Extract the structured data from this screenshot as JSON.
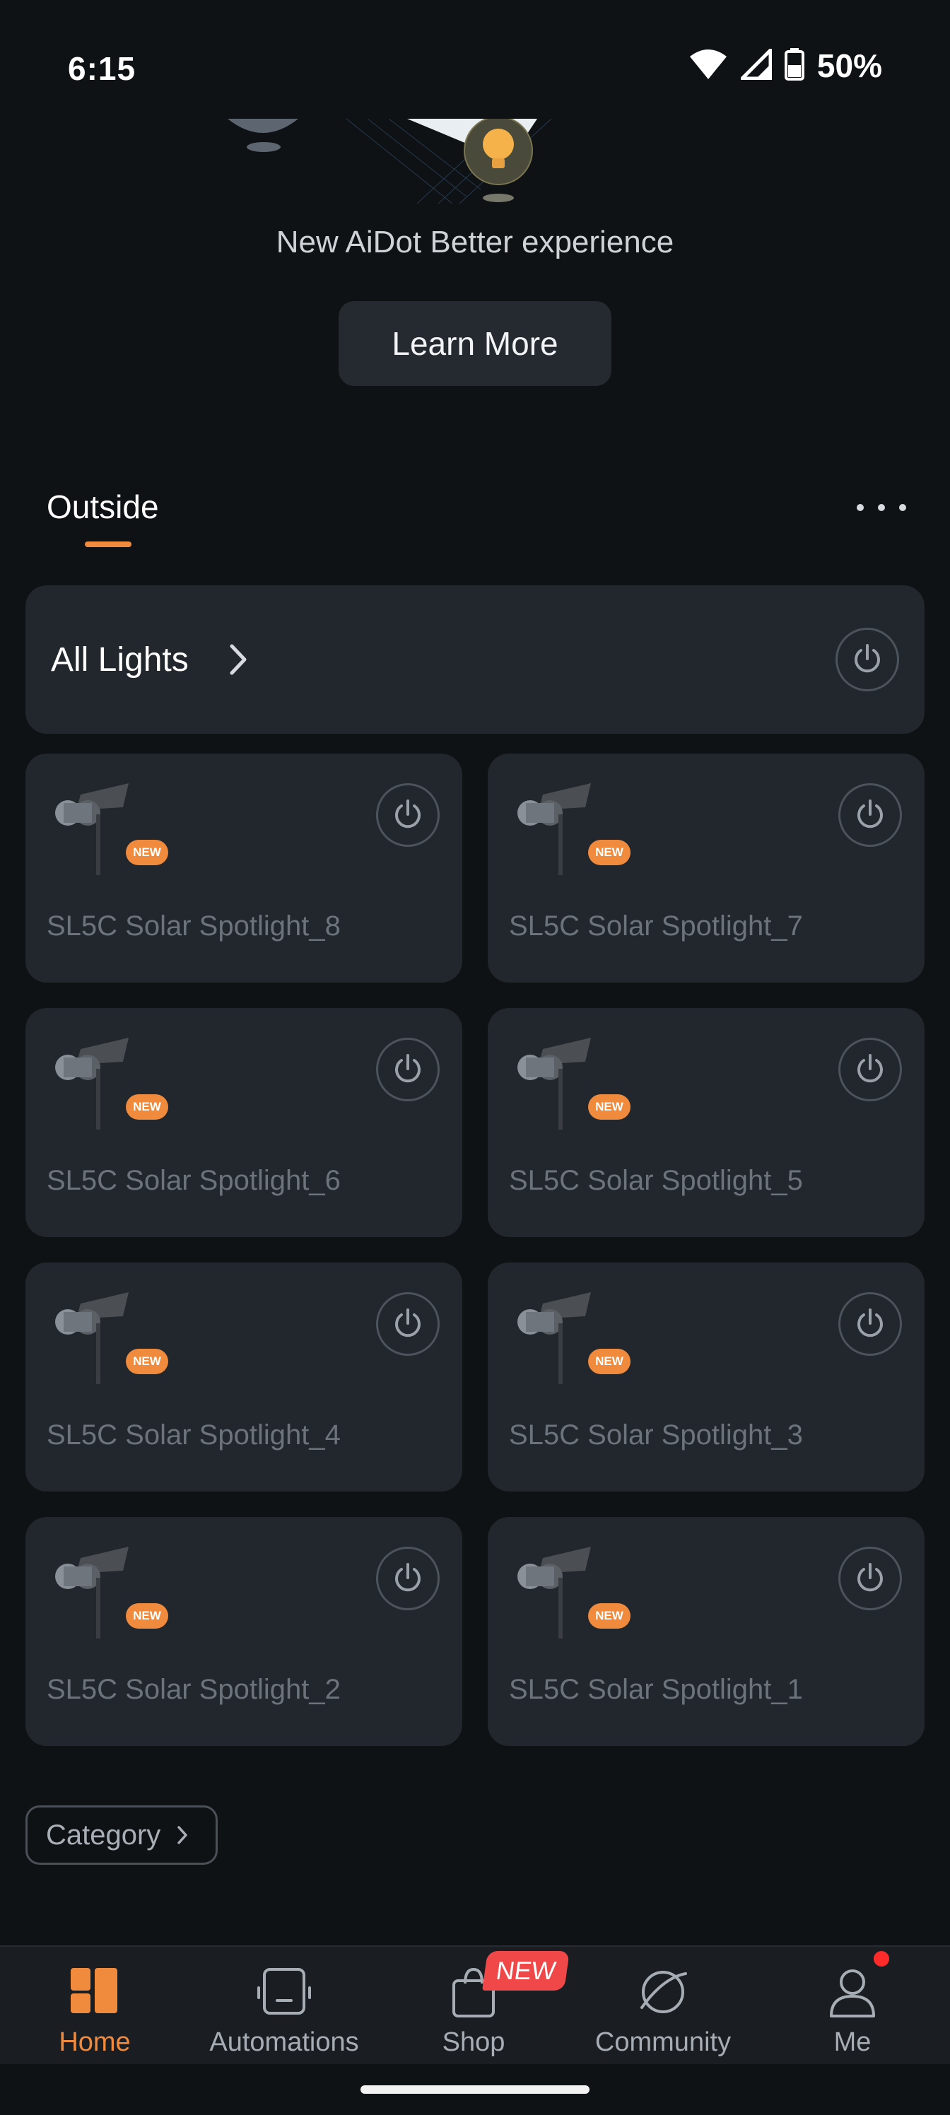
{
  "status_bar": {
    "time": "6:15",
    "battery": "50%"
  },
  "banner": {
    "text": "New AiDot Better experience",
    "button": "Learn More"
  },
  "room": {
    "tab_label": "Outside"
  },
  "all_lights": {
    "label": "All Lights"
  },
  "devices": [
    {
      "name": "SL5C Solar Spotlight_8",
      "badge": "NEW"
    },
    {
      "name": "SL5C Solar Spotlight_7",
      "badge": "NEW"
    },
    {
      "name": "SL5C Solar Spotlight_6",
      "badge": "NEW"
    },
    {
      "name": "SL5C Solar Spotlight_5",
      "badge": "NEW"
    },
    {
      "name": "SL5C Solar Spotlight_4",
      "badge": "NEW"
    },
    {
      "name": "SL5C Solar Spotlight_3",
      "badge": "NEW"
    },
    {
      "name": "SL5C Solar Spotlight_2",
      "badge": "NEW"
    },
    {
      "name": "SL5C Solar Spotlight_1",
      "badge": "NEW"
    }
  ],
  "category": {
    "label": "Category"
  },
  "nav": {
    "home": "Home",
    "automations": "Automations",
    "shop": "Shop",
    "shop_badge": "NEW",
    "community": "Community",
    "me": "Me"
  },
  "colors": {
    "accent": "#f08a3c",
    "card": "#22272d",
    "background": "#0f1215",
    "badge_red": "#f04848"
  }
}
